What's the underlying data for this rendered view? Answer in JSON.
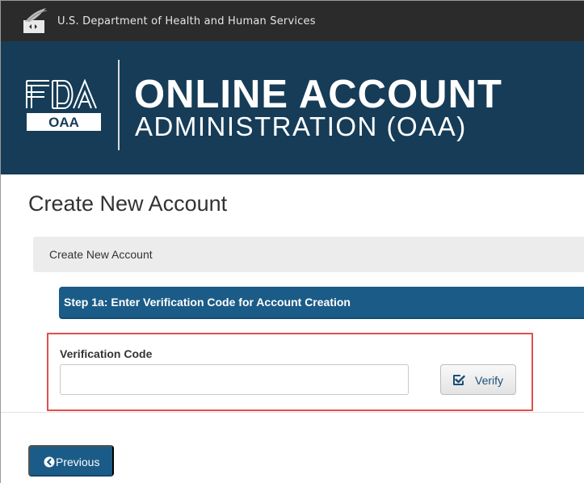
{
  "header": {
    "agency_name": "U.S. Department of Health and Human Services",
    "logo_icon": "hhs-eagle-icon"
  },
  "banner": {
    "fda_logo_text": "FDA",
    "fda_logo_badge": "OAA",
    "title_line1": "ONLINE ACCOUNT",
    "title_line2": "ADMINISTRATION (OAA)",
    "background_color": "#163c57"
  },
  "page": {
    "title": "Create New Account"
  },
  "panel": {
    "heading": "Create New Account"
  },
  "step": {
    "title": "Step 1a: Enter Verification Code for Account Creation",
    "color": "#1b5b87"
  },
  "form": {
    "verification_label": "Verification Code",
    "verification_value": "",
    "verification_placeholder": "",
    "verify_button_label": "Verify",
    "verify_icon": "check-square-icon",
    "highlight_color": "#e0504f"
  },
  "footer": {
    "previous_button_label": "Previous",
    "previous_icon": "chevron-left-circle-icon"
  }
}
